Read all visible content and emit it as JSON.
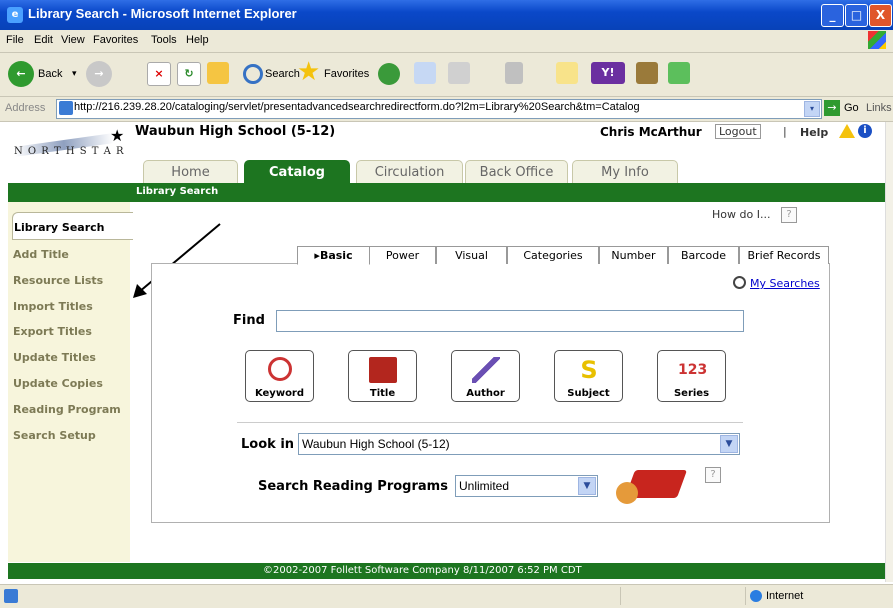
{
  "window": {
    "title": "Library Search - Microsoft Internet Explorer",
    "controls": [
      "_",
      "□",
      "X"
    ]
  },
  "menu": [
    "File",
    "Edit",
    "View",
    "Favorites",
    "Tools",
    "Help"
  ],
  "toolbar": {
    "back": "Back",
    "search": "Search",
    "favorites": "Favorites"
  },
  "address": {
    "label": "Address",
    "url": "http://216.239.28.20/cataloging/servlet/presentadvancedsearchredirectform.do?l2m=Library%20Search&tm=Catalog",
    "go": "Go",
    "links": "Links"
  },
  "header": {
    "logo_text": "NORTH STAR",
    "school": "Waubun High School (5-12)",
    "user": "Chris McArthur",
    "logout": "Logout",
    "separator": "|",
    "help": "Help",
    "tabs": [
      "Home",
      "Catalog",
      "Circulation",
      "Back Office",
      "My Info"
    ],
    "active_tab": "Catalog",
    "breadcrumb": "Library Search"
  },
  "sidebar": {
    "items": [
      "Library Search",
      "Add Title",
      "Resource Lists",
      "Import Titles",
      "Export Titles",
      "Update Titles",
      "Update Copies",
      "Reading Program",
      "Search Setup"
    ]
  },
  "main": {
    "how_do_i": "How do I...",
    "help_mark": "?",
    "search_tabs": [
      "Basic",
      "Power",
      "Visual",
      "Categories",
      "Number",
      "Barcode",
      "Brief Records"
    ],
    "active_search_tab": "Basic",
    "my_searches": "My Searches",
    "find_label": "Find",
    "find_value": "",
    "search_buttons": [
      "Keyword",
      "Title",
      "Author",
      "Subject",
      "Series"
    ],
    "look_in_label": "Look in",
    "look_in_value": "Waubun High School (5-12)",
    "reading_programs_label": "Search Reading Programs",
    "reading_programs_value": "Unlimited"
  },
  "footer": {
    "copyright": "©2002-2007  Follett Software Company     8/11/2007 6:52 PM CDT"
  },
  "status": {
    "zone": "Internet"
  },
  "colors": {
    "accent_green": "#1d7520",
    "sidebar_bg": "#f7f5dc",
    "titlebar_blue": "#0a48c9"
  }
}
